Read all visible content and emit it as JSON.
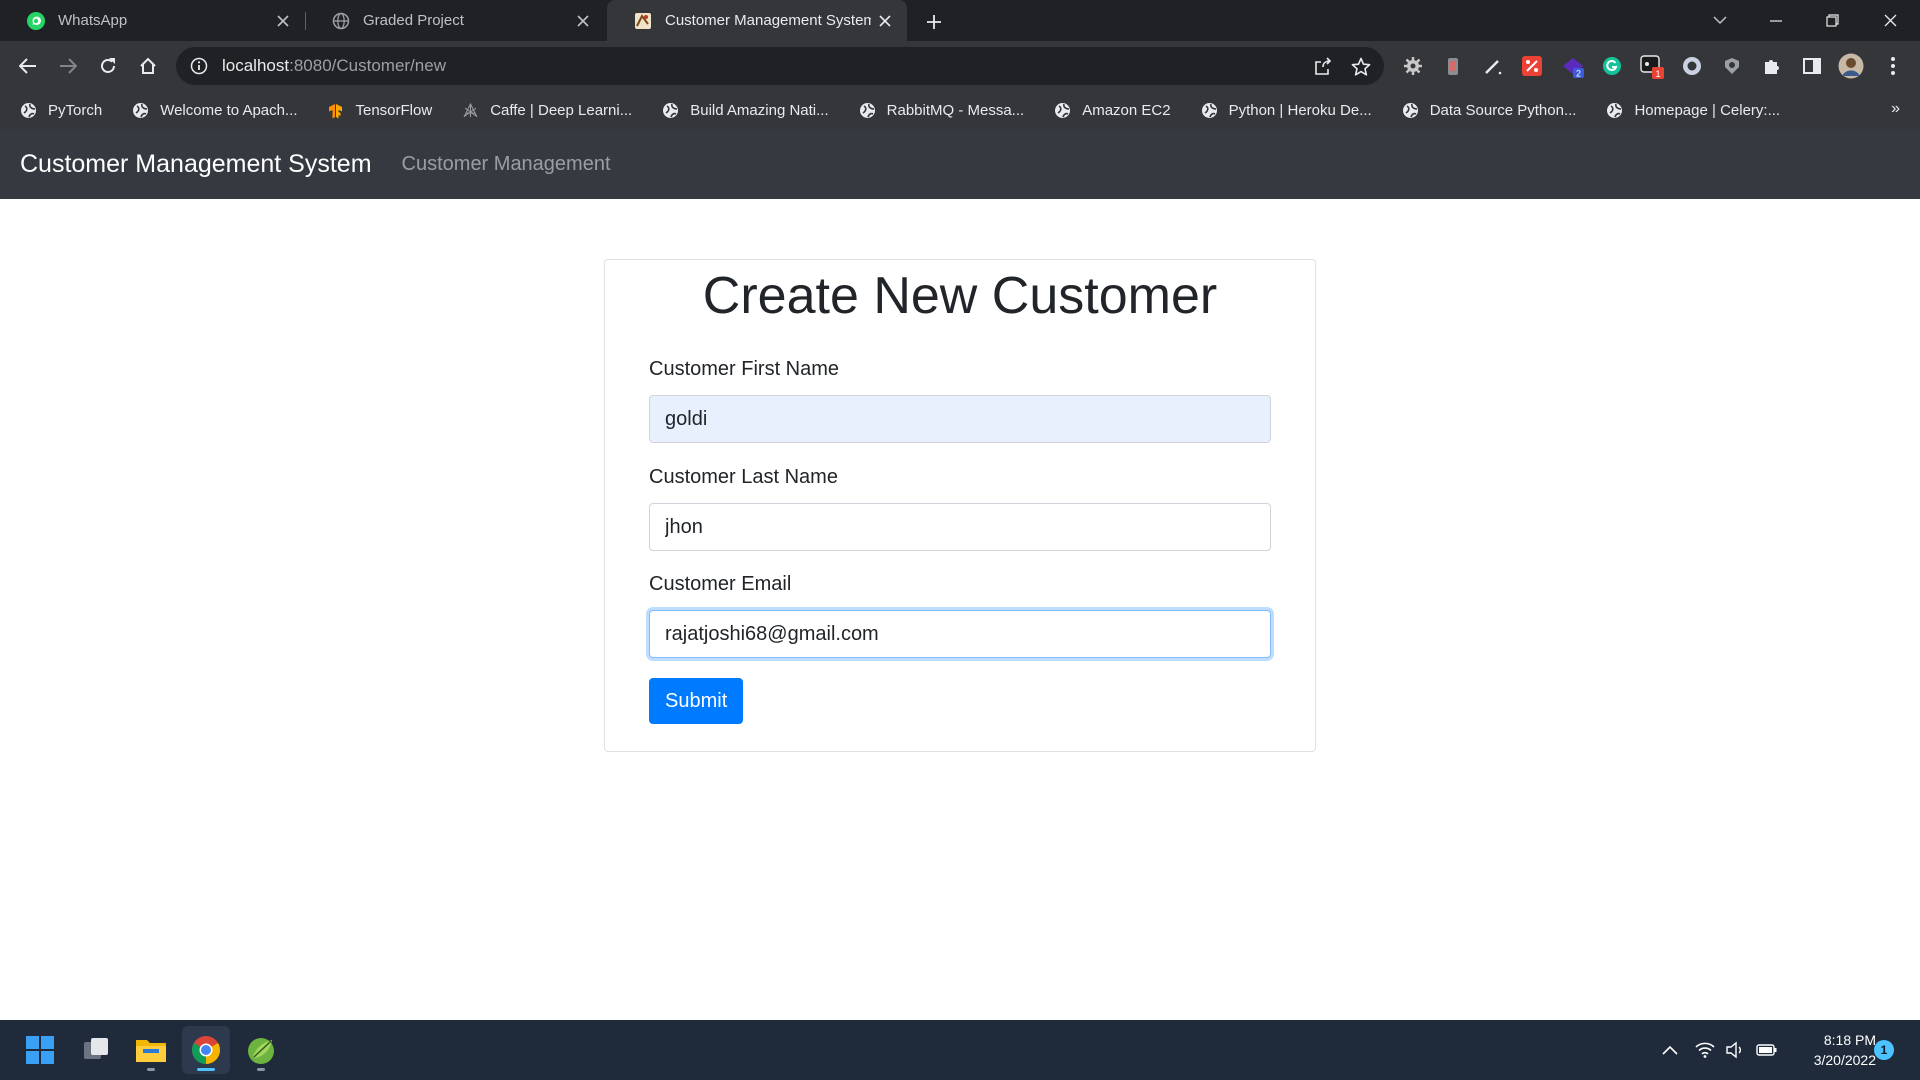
{
  "browser": {
    "tabs": [
      {
        "title": "WhatsApp",
        "icon": "whatsapp-icon",
        "active": false
      },
      {
        "title": "Graded Project",
        "icon": "globe-icon",
        "active": false
      },
      {
        "title": "Customer Management System",
        "icon": "page-favicon",
        "active": true
      }
    ],
    "url": {
      "host": "localhost",
      "path": ":8080/Customer/new"
    },
    "extension_badges": {
      "purple_ext": "2",
      "ext_red": "1"
    },
    "bookmarks": [
      {
        "label": "PyTorch",
        "icon": "globe-icon"
      },
      {
        "label": "Welcome to Apach...",
        "icon": "globe-icon"
      },
      {
        "label": "TensorFlow",
        "icon": "tensorflow-icon"
      },
      {
        "label": "Caffe | Deep Learni...",
        "icon": "caffe-icon"
      },
      {
        "label": "Build Amazing Nati...",
        "icon": "globe-icon"
      },
      {
        "label": "RabbitMQ - Messa...",
        "icon": "globe-icon"
      },
      {
        "label": "Amazon EC2",
        "icon": "globe-icon"
      },
      {
        "label": "Python | Heroku De...",
        "icon": "globe-icon"
      },
      {
        "label": "Data Source Python...",
        "icon": "globe-icon"
      },
      {
        "label": "Homepage | Celery:...",
        "icon": "globe-icon"
      }
    ],
    "bookmarks_more": "»"
  },
  "app": {
    "brand": "Customer Management System",
    "nav_link": "Customer Management"
  },
  "form": {
    "heading": "Create New Customer",
    "first_name": {
      "label": "Customer First Name",
      "value": "goldi"
    },
    "last_name": {
      "label": "Customer Last Name",
      "value": "jhon"
    },
    "email": {
      "label": "Customer Email",
      "value": "rajatjoshi68@gmail.com"
    },
    "submit_label": "Submit"
  },
  "taskbar": {
    "time": "8:18 PM",
    "date": "3/20/2022",
    "notification_count": "1"
  },
  "colors": {
    "navbar_bg": "#343a40",
    "primary": "#007bff",
    "autofill_bg": "#e8f0fe",
    "chrome_dark": "#202124",
    "chrome_toolbar": "#35363a"
  }
}
